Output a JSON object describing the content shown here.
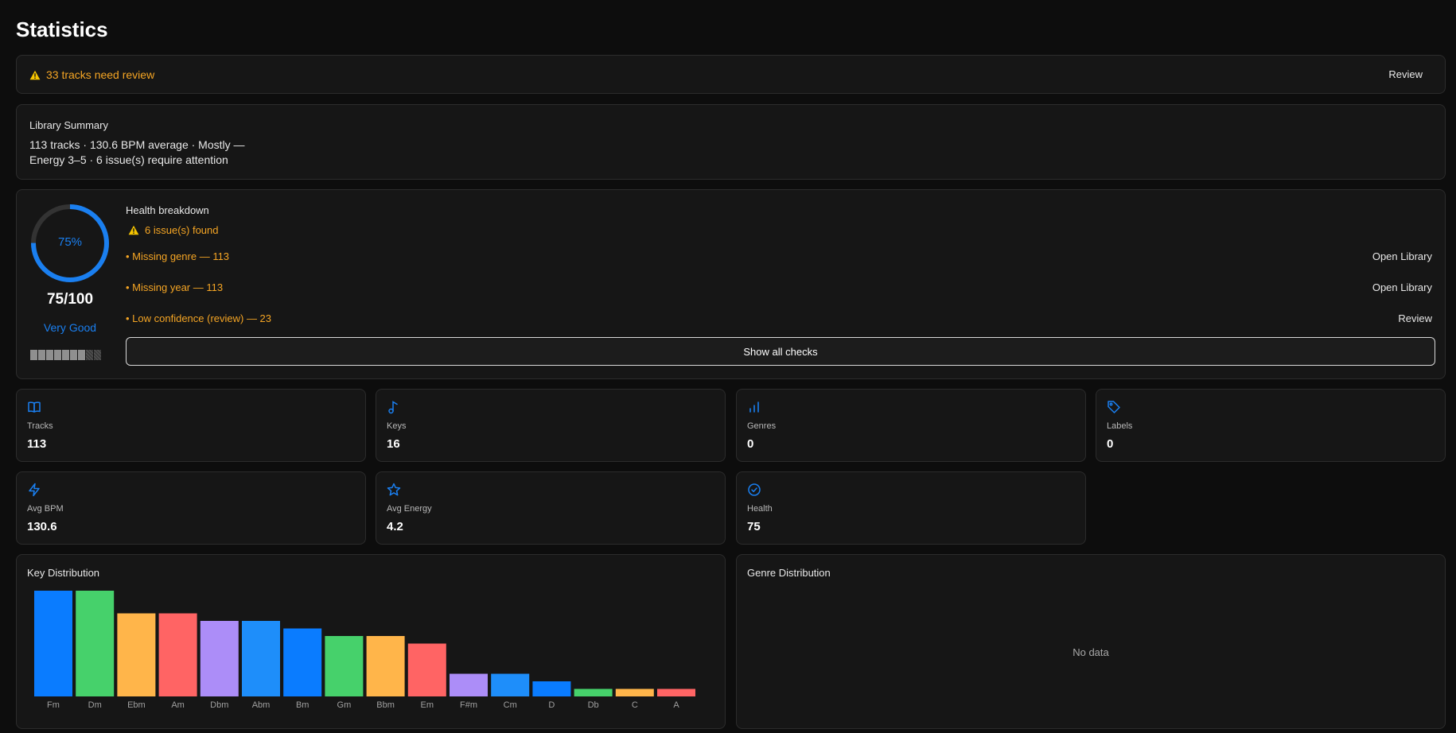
{
  "page": {
    "title": "Statistics"
  },
  "review_banner": {
    "message": "33 tracks need review",
    "action_label": "Review"
  },
  "library_summary": {
    "label": "Library Summary",
    "line1": "113 tracks · 130.6 BPM average · Mostly —",
    "line2": "Energy 3–5 · 6 issue(s) require attention"
  },
  "health": {
    "gauge_percent_label": "75%",
    "gauge_fraction": 0.75,
    "score": "75/100",
    "grade": "Very Good",
    "mini_bars_total": 9,
    "mini_bars_filled": 7,
    "breakdown_title": "Health breakdown",
    "issues_found": "6 issue(s) found",
    "issues": [
      {
        "text": "• Missing genre — 113",
        "action": "Open Library"
      },
      {
        "text": "• Missing year — 113",
        "action": "Open Library"
      },
      {
        "text": "• Low confidence (review) — 23",
        "action": "Review"
      }
    ],
    "show_all_label": "Show all checks"
  },
  "stats": [
    {
      "label": "Tracks",
      "value": "113",
      "icon": "book-icon"
    },
    {
      "label": "Keys",
      "value": "16",
      "icon": "music-note-icon"
    },
    {
      "label": "Genres",
      "value": "0",
      "icon": "bar-chart-icon"
    },
    {
      "label": "Labels",
      "value": "0",
      "icon": "tag-icon"
    },
    {
      "label": "Avg BPM",
      "value": "130.6",
      "icon": "lightning-icon"
    },
    {
      "label": "Avg Energy",
      "value": "4.2",
      "icon": "star-icon"
    },
    {
      "label": "Health",
      "value": "75",
      "icon": "check-circle-icon"
    }
  ],
  "colors": {
    "accent": "#1a7ff0",
    "warning": "#f5a524",
    "bar_palette": [
      "#0a7cff",
      "#46d16b",
      "#ffb54a",
      "#ff6464",
      "#ac8df8",
      "#1e8efa"
    ]
  },
  "genre_distribution": {
    "title": "Genre Distribution",
    "empty_text": "No data"
  },
  "chart_data": {
    "type": "bar",
    "title": "Key Distribution",
    "categories": [
      "Fm",
      "Dm",
      "Ebm",
      "Am",
      "Dbm",
      "Abm",
      "Bm",
      "Gm",
      "Bbm",
      "Em",
      "F#m",
      "Cm",
      "D",
      "Db",
      "C",
      "A"
    ],
    "values": [
      14,
      14,
      11,
      11,
      10,
      10,
      9,
      8,
      8,
      7,
      3,
      3,
      2,
      1,
      1,
      1
    ],
    "bar_colors": [
      "#0a7cff",
      "#46d16b",
      "#ffb54a",
      "#ff6464",
      "#ac8df8",
      "#1e8efa",
      "#0a7cff",
      "#46d16b",
      "#ffb54a",
      "#ff6464",
      "#ac8df8",
      "#1e8efa",
      "#0a7cff",
      "#46d16b",
      "#ffb54a",
      "#ff6464"
    ],
    "xlabel": "",
    "ylabel": "",
    "grid": false,
    "legend": "none"
  }
}
